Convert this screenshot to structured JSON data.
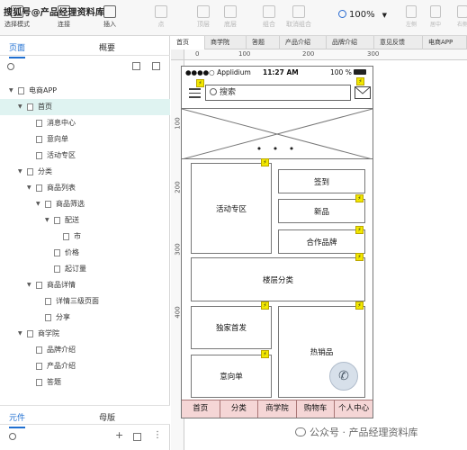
{
  "watermark_top": "搜狐号@产品经理资料库",
  "toolbar": {
    "buttons": [
      {
        "label": "选择模式",
        "icon": "select-mode-icon"
      },
      {
        "label": "连接",
        "icon": "connect-icon"
      },
      {
        "label": "插入",
        "icon": "insert-icon"
      },
      {
        "label": "点",
        "icon": "point-icon"
      },
      {
        "label": "顶层",
        "icon": "bring-front-icon"
      },
      {
        "label": "底层",
        "icon": "send-back-icon"
      },
      {
        "label": "组合",
        "icon": "group-icon"
      },
      {
        "label": "取消组合",
        "icon": "ungroup-icon"
      },
      {
        "label": "左侧",
        "icon": "align-left-icon"
      },
      {
        "label": "居中",
        "icon": "align-center-icon"
      },
      {
        "label": "右侧",
        "icon": "align-right-icon"
      }
    ],
    "zoom": "100%"
  },
  "left_panel": {
    "tabs": [
      "页面",
      "概要"
    ],
    "tree": [
      {
        "label": "电商APP",
        "depth": 0,
        "caret": "▼"
      },
      {
        "label": "首页",
        "depth": 1,
        "caret": "▼",
        "selected": true
      },
      {
        "label": "消息中心",
        "depth": 2,
        "caret": ""
      },
      {
        "label": "意向单",
        "depth": 2,
        "caret": ""
      },
      {
        "label": "活动专区",
        "depth": 2,
        "caret": ""
      },
      {
        "label": "分类",
        "depth": 1,
        "caret": "▼"
      },
      {
        "label": "商品列表",
        "depth": 2,
        "caret": "▼"
      },
      {
        "label": "商品筛选",
        "depth": 3,
        "caret": "▼"
      },
      {
        "label": "配送",
        "depth": 4,
        "caret": "▼"
      },
      {
        "label": "市",
        "depth": 5,
        "caret": ""
      },
      {
        "label": "价格",
        "depth": 4,
        "caret": ""
      },
      {
        "label": "起订量",
        "depth": 4,
        "caret": ""
      },
      {
        "label": "商品详情",
        "depth": 2,
        "caret": "▼"
      },
      {
        "label": "详情三级页面",
        "depth": 3,
        "caret": ""
      },
      {
        "label": "分享",
        "depth": 3,
        "caret": ""
      },
      {
        "label": "商学院",
        "depth": 1,
        "caret": "▼"
      },
      {
        "label": "品牌介绍",
        "depth": 2,
        "caret": ""
      },
      {
        "label": "产品介绍",
        "depth": 2,
        "caret": ""
      },
      {
        "label": "答题",
        "depth": 2,
        "caret": ""
      }
    ],
    "bottom_tabs": [
      "元件",
      "母版"
    ]
  },
  "doc_tabs": [
    "首页",
    "商学院",
    "答题",
    "产品介绍",
    "品牌介绍",
    "意见反馈",
    "电商APP"
  ],
  "rulers": {
    "h": [
      "0",
      "100",
      "200",
      "300"
    ],
    "v": [
      "100",
      "200",
      "300",
      "400"
    ]
  },
  "phone": {
    "status_left": "●●●●○ Applidium",
    "status_time": "11:27 AM",
    "status_right": "100 %",
    "search_text": "搜索",
    "banner_dots": "• • •",
    "blocks": {
      "activity": "活动专区",
      "signin": "签到",
      "new": "新品",
      "partner": "合作品牌",
      "floor": "楼层分类",
      "exclusive": "独家首发",
      "hot": "热销品",
      "intent": "意向单"
    },
    "nav": [
      "首页",
      "分类",
      "商学院",
      "购物车",
      "个人中心"
    ]
  },
  "brand_watermark": "公众号 · 产品经理资料库"
}
